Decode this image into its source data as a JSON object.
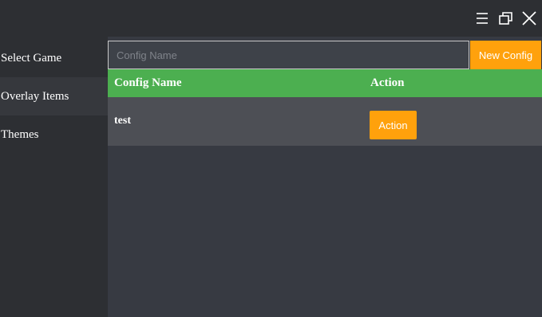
{
  "window": {
    "controls": [
      "menu-icon",
      "restore-icon",
      "close-icon"
    ]
  },
  "sidebar": {
    "items": [
      {
        "label": "Select Game",
        "active": false
      },
      {
        "label": "Overlay Items",
        "active": true
      },
      {
        "label": "Themes",
        "active": false
      }
    ]
  },
  "main": {
    "config_input": {
      "value": "",
      "placeholder": "Config Name"
    },
    "new_config_label": "New Config",
    "table": {
      "headers": [
        "Config Name",
        "Action"
      ],
      "rows": [
        {
          "name": "test",
          "action_label": "Action"
        }
      ]
    }
  },
  "colors": {
    "background": "#2d2f33",
    "main_background": "#373a42",
    "header_green": "#4caf50",
    "accent_orange": "#ffa10c",
    "row_background": "#4d4f55"
  }
}
